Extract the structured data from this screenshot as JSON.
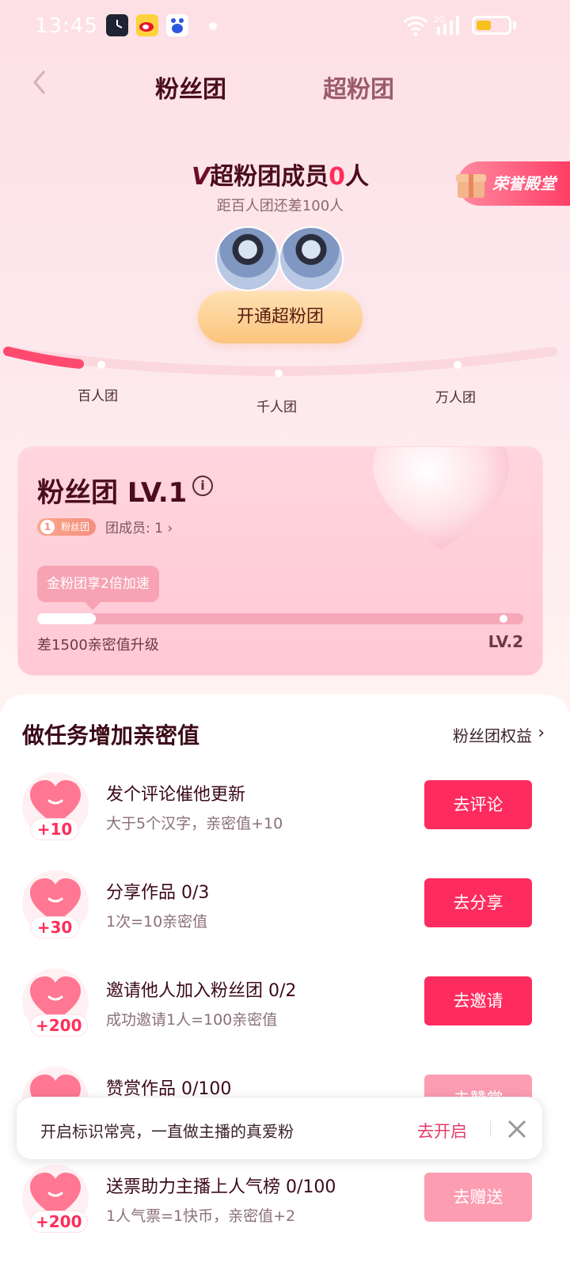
{
  "status_bar": {
    "time": "13:45",
    "icons": [
      "clock-app-icon",
      "weibo-icon",
      "baidu-icon",
      "wifi-icon",
      "signal-icon",
      "battery-icon"
    ]
  },
  "header": {
    "back_icon": "chevron-left-icon",
    "tabs": [
      {
        "label": "粉丝团",
        "active": true
      },
      {
        "label": "超粉团",
        "active": false
      }
    ]
  },
  "super_fan": {
    "title_prefix": "V",
    "title_main": "超粉团成员",
    "member_count": "0",
    "title_suffix": "人",
    "subtitle": "距百人团还差100人",
    "hall_badge": "荣誉殿堂",
    "open_button": "开通超粉团",
    "milestones": [
      "百人团",
      "千人团",
      "万人团"
    ]
  },
  "level_card": {
    "title": "粉丝团 LV.1",
    "badge_number": "1",
    "badge_label": "粉丝团",
    "member_text": "团成员: 1",
    "speed_tag": "金粉团享2倍加速",
    "progress_fraction": 0.12,
    "progress_note": "差1500亲密值升级",
    "next_level": "LV.2"
  },
  "tasks_section": {
    "heading": "做任务增加亲密值",
    "benefits_link": "粉丝团权益",
    "items": [
      {
        "points": "+10",
        "title": "发个评论催他更新",
        "desc": "大于5个汉字，亲密值+10",
        "button": "去评论"
      },
      {
        "points": "+30",
        "title": "分享作品  0/3",
        "desc": "1次=10亲密值",
        "button": "去分享"
      },
      {
        "points": "+200",
        "title": "邀请他人加入粉丝团  0/2",
        "desc": "成功邀请1人=100亲密值",
        "button": "去邀请"
      },
      {
        "points": "",
        "title": "赞赏作品  0/100",
        "desc": "",
        "button": "去赞赏"
      },
      {
        "points": "+200",
        "title": "送票助力主播上人气榜  0/100",
        "desc": "1人气票=1快币，亲密值+2",
        "button": "去赠送"
      }
    ]
  },
  "toast": {
    "text": "开启标识常亮，一直做主播的真爱粉",
    "action": "去开启",
    "close_icon": "close-icon"
  },
  "colors": {
    "accent": "#fe2c5e",
    "accent_faded": "#fc9db2",
    "title_dark": "#4a0c1e",
    "gold_button": "#fbc47d"
  }
}
